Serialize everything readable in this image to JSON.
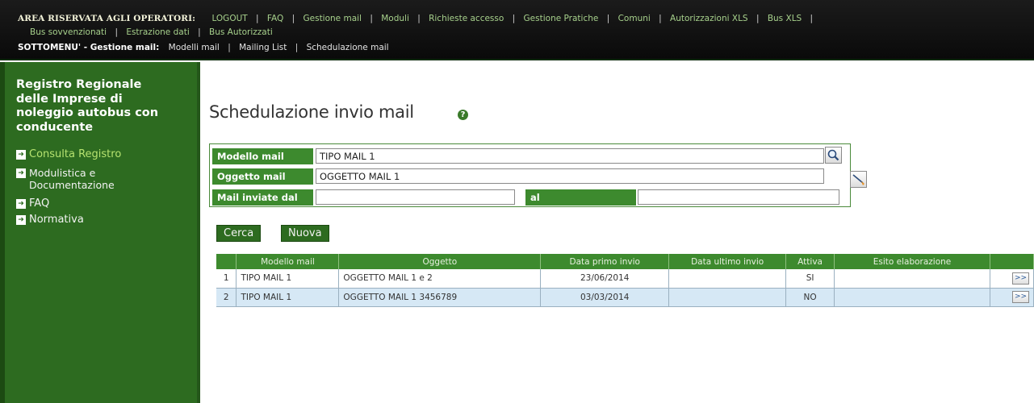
{
  "topbar": {
    "title": "AREA RISERVATA AGLI OPERATORI:",
    "row1": [
      "LOGOUT",
      "FAQ",
      "Gestione mail",
      "Moduli",
      "Richieste accesso",
      "Gestione Pratiche",
      "Comuni",
      "Autorizzazioni XLS",
      "Bus XLS"
    ],
    "row2": [
      "Bus sovvenzionati",
      "Estrazione dati",
      "Bus Autorizzati"
    ],
    "submenu_title": "SOTTOMENU' - Gestione mail:",
    "submenu": [
      "Modelli mail",
      "Mailing List",
      "Schedulazione mail"
    ]
  },
  "sidebar": {
    "title": "Registro Regionale delle Imprese di noleggio autobus con conducente",
    "items": [
      {
        "label": "Consulta Registro"
      },
      {
        "label": "Modulistica e Documentazione"
      },
      {
        "label": "FAQ"
      },
      {
        "label": "Normativa"
      }
    ],
    "colors": {
      "background": "#2d6b20",
      "active": "#b6e26f"
    }
  },
  "main": {
    "page_title": "Schedulazione invio mail",
    "help_icon": "question-circle-icon",
    "filters": {
      "modello_label": "Modello mail",
      "modello_value": "TIPO MAIL 1",
      "oggetto_label": "Oggetto mail",
      "oggetto_value": "OGGETTO MAIL 1",
      "dal_label": "Mail inviate dal",
      "dal_value": "",
      "al_label": "al",
      "al_value": ""
    },
    "buttons": {
      "search": "Cerca",
      "new": "Nuova"
    },
    "table": {
      "headers": [
        "",
        "Modello mail",
        "Oggetto",
        "Data primo invio",
        "Data ultimo invio",
        "Attiva",
        "Esito elaborazione",
        ""
      ],
      "rows": [
        {
          "n": "1",
          "modello": "TIPO MAIL 1",
          "oggetto": "OGGETTO MAIL 1 e 2",
          "primo": "23/06/2014",
          "ultimo": "",
          "attiva": "SI",
          "esito": "",
          "go": ">>"
        },
        {
          "n": "2",
          "modello": "TIPO MAIL 1",
          "oggetto": "OGGETTO MAIL 1 3456789",
          "primo": "03/03/2014",
          "ultimo": "",
          "attiva": "NO",
          "esito": "",
          "go": ">>"
        }
      ]
    },
    "colors": {
      "accent": "#3d8a2e",
      "row_alt": "#d6e8f5"
    }
  }
}
